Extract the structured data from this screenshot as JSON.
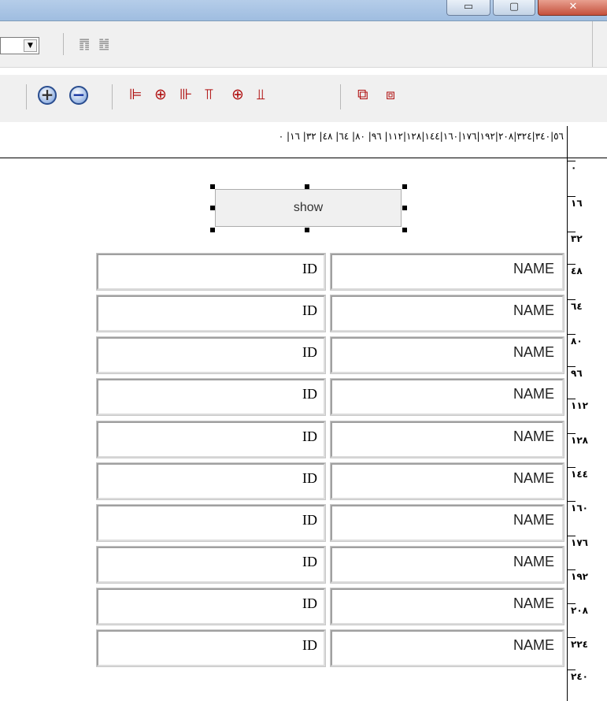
{
  "window": {
    "minimize_glyph": "▭",
    "maximize_glyph": "▢",
    "close_glyph": "✕"
  },
  "toolbar1": {
    "combo_arrow": "▼",
    "icons": [
      "䷓",
      "䷐"
    ]
  },
  "toolbar2": {
    "zoom_in": "+",
    "zoom_out": "−",
    "align_icons": [
      "⊫",
      "⊕",
      "⊪",
      "⫪",
      "⊕",
      "⫫"
    ],
    "order_icons": [
      "⧉",
      "⧈"
    ]
  },
  "ruler": {
    "labels": "٥٦|٣٤٠|٣٢٤|٢٠٨|١٩٢|١٧٦|١٦٠|١٤٤|١٢٨|١١٢| ٩٦| ٨٠| ٦٤| ٤٨| ٣٢| ١٦| ٠",
    "vertical": [
      "٠",
      "١٦",
      "٣٢",
      "٤٨",
      "٦٤",
      "٨٠",
      "٩٦",
      "١١٢",
      "١٢٨",
      "١٤٤",
      "١٦٠",
      "١٧٦",
      "١٩٢",
      "٢٠٨",
      "٢٢٤",
      "٢٤٠"
    ]
  },
  "form": {
    "show_button": "show",
    "rows": [
      {
        "id": "ID",
        "name": "NAME"
      },
      {
        "id": "ID",
        "name": "NAME"
      },
      {
        "id": "ID",
        "name": "NAME"
      },
      {
        "id": "ID",
        "name": "NAME"
      },
      {
        "id": "ID",
        "name": "NAME"
      },
      {
        "id": "ID",
        "name": "NAME"
      },
      {
        "id": "ID",
        "name": "NAME"
      },
      {
        "id": "ID",
        "name": "NAME"
      },
      {
        "id": "ID",
        "name": "NAME"
      },
      {
        "id": "ID",
        "name": "NAME"
      }
    ]
  }
}
